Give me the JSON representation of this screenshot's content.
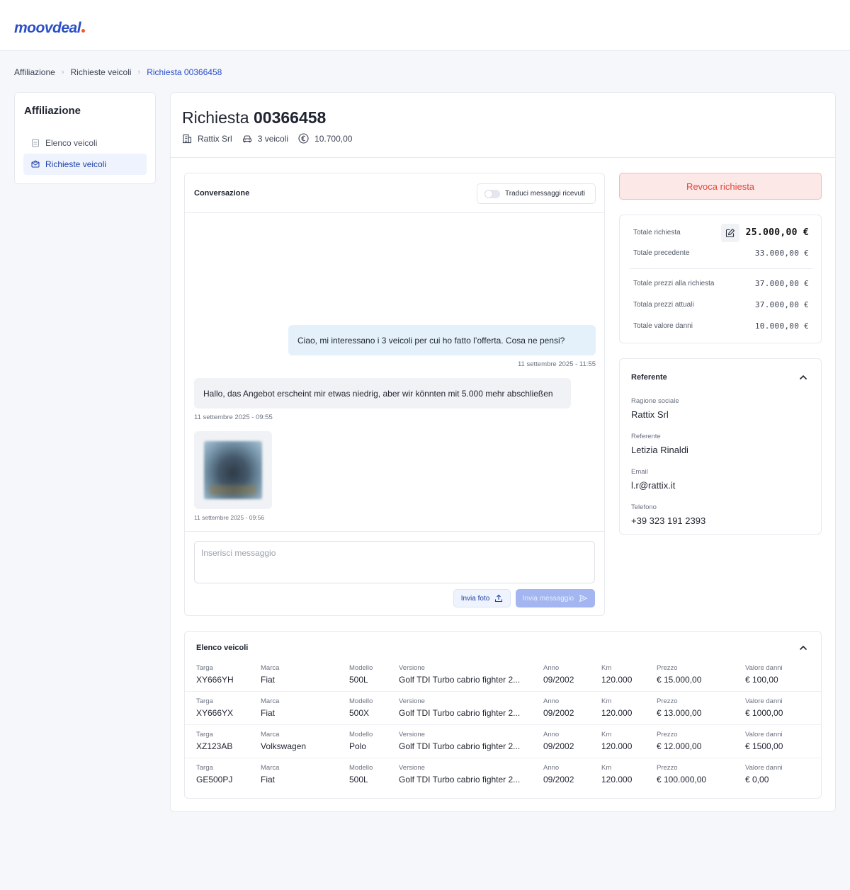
{
  "brand": {
    "name": "moovdeal",
    "accent": "#2b4ec9",
    "dot_color": "#f05a28"
  },
  "breadcrumb": [
    "Affiliazione",
    "Richieste veicoli",
    "Richiesta 00366458"
  ],
  "sidebar": {
    "title": "Affiliazione",
    "items": [
      {
        "label": "Elenco veicoli",
        "icon": "list-icon",
        "active": false
      },
      {
        "label": "Richieste veicoli",
        "icon": "mail-icon",
        "active": true
      }
    ]
  },
  "request": {
    "title_prefix": "Richiesta",
    "title_number": "00366458",
    "company": "Rattix Srl",
    "vehicles": "3 veicoli",
    "amount": "10.700,00"
  },
  "conversation": {
    "title": "Conversazione",
    "translate_label": "Traduci messaggi ricevuti",
    "messages": [
      {
        "direction": "out",
        "text": "Ciao, mi interessano i 3 veicoli per cui ho fatto l’offerta. Cosa ne pensi?",
        "time": "11 settembre 2025 - 11:55"
      },
      {
        "direction": "in",
        "text": "Hallo, das Angebot erscheint mir etwas niedrig, aber wir könnten mit 5.000 mehr abschließen",
        "time": "11 settembre 2025 - 09:55"
      },
      {
        "direction": "in",
        "type": "image",
        "time": "11 settembre 2025 - 09:56"
      }
    ],
    "input_placeholder": "Inserisci messaggio",
    "photo_button": "Invia foto",
    "send_button": "Invia messaggio"
  },
  "revoke_button": "Revoca richiesta",
  "totals": [
    {
      "label": "Totale richiesta",
      "value": "25.000,00 €",
      "emphasis": true
    },
    {
      "label": "Totale precedente",
      "value": "33.000,00 €"
    },
    {
      "label": "Totale prezzi alla richiesta",
      "value": "37.000,00 €"
    },
    {
      "label": "Totala prezzi attuali",
      "value": "37.000,00 €"
    },
    {
      "label": "Totale valore danni",
      "value": "10.000,00 €"
    }
  ],
  "referente": {
    "title": "Referente",
    "fields": [
      {
        "label": "Ragione sociale",
        "value": "Rattix Srl"
      },
      {
        "label": "Referente",
        "value": "Letizia Rinaldi"
      },
      {
        "label": "Email",
        "value": "l.r@rattix.it"
      },
      {
        "label": "Telefono",
        "value": "+39 323 191 2393"
      }
    ]
  },
  "vehicles": {
    "title": "Elenco veicoli",
    "headers": [
      "Targa",
      "Marca",
      "Modello",
      "Versione",
      "Anno",
      "Km",
      "Prezzo",
      "Valore danni"
    ],
    "rows": [
      [
        "XY666YH",
        "Fiat",
        "500L",
        "Golf TDI Turbo cabrio fighter 2...",
        "09/2002",
        "120.000",
        "€ 15.000,00",
        "€ 100,00"
      ],
      [
        "XY666YX",
        "Fiat",
        "500X",
        "Golf TDI Turbo cabrio fighter 2...",
        "09/2002",
        "120.000",
        "€ 13.000,00",
        "€ 1000,00"
      ],
      [
        "XZ123AB",
        "Volkswagen",
        "Polo",
        "Golf TDI Turbo cabrio fighter 2...",
        "09/2002",
        "120.000",
        "€ 12.000,00",
        "€ 1500,00"
      ],
      [
        "GE500PJ",
        "Fiat",
        "500L",
        "Golf TDI Turbo cabrio fighter 2...",
        "09/2002",
        "120.000",
        "€ 100.000,00",
        "€ 0,00"
      ]
    ]
  }
}
